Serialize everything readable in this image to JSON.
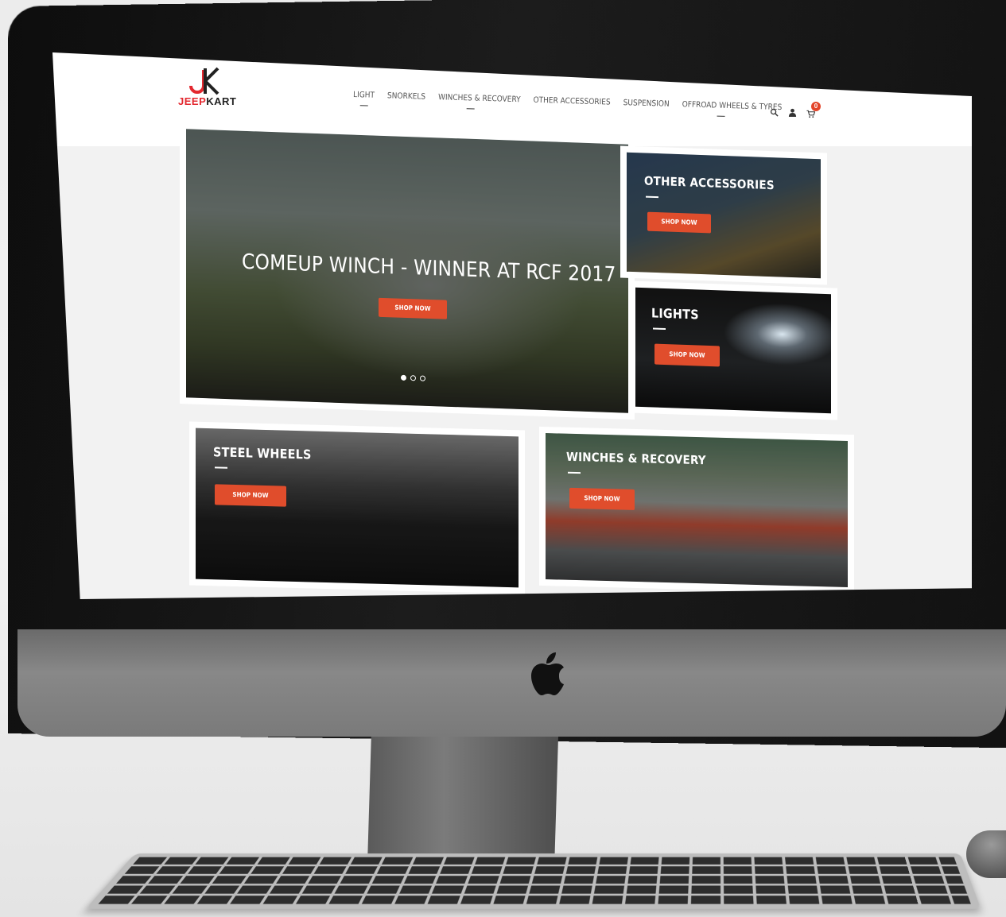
{
  "brand": {
    "name_part1": "JEEP",
    "name_part2": "KART",
    "logo_mark": "JK"
  },
  "nav": {
    "items": [
      {
        "label": "LIGHT",
        "active": true
      },
      {
        "label": "SNORKELS",
        "active": false
      },
      {
        "label": "WINCHES & RECOVERY",
        "active": true
      },
      {
        "label": "OTHER ACCESSORIES",
        "active": false
      },
      {
        "label": "SUSPENSION",
        "active": false
      },
      {
        "label": "OFFROAD WHEELS & TYRES",
        "active": true
      }
    ]
  },
  "header_icons": {
    "search": "search-icon",
    "account": "user-icon",
    "cart": "cart-icon",
    "cart_count": "0"
  },
  "hero": {
    "title": "COMEUP WINCH - WINNER AT RCF 2017",
    "button": "SHOP NOW",
    "slides": 3,
    "active_slide": 1
  },
  "tiles": {
    "other_accessories": {
      "title": "OTHER ACCESSORIES",
      "button": "SHOP NOW"
    },
    "lights": {
      "title": "LIGHTS",
      "button": "SHOP NOW"
    },
    "steel_wheels": {
      "title": "STEEL WHEELS",
      "button": "SHOP NOW"
    },
    "winches": {
      "title": "WINCHES & RECOVERY",
      "button": "SHOP NOW"
    }
  },
  "colors": {
    "accent": "#e04d2c",
    "logo_red": "#e3282f"
  }
}
